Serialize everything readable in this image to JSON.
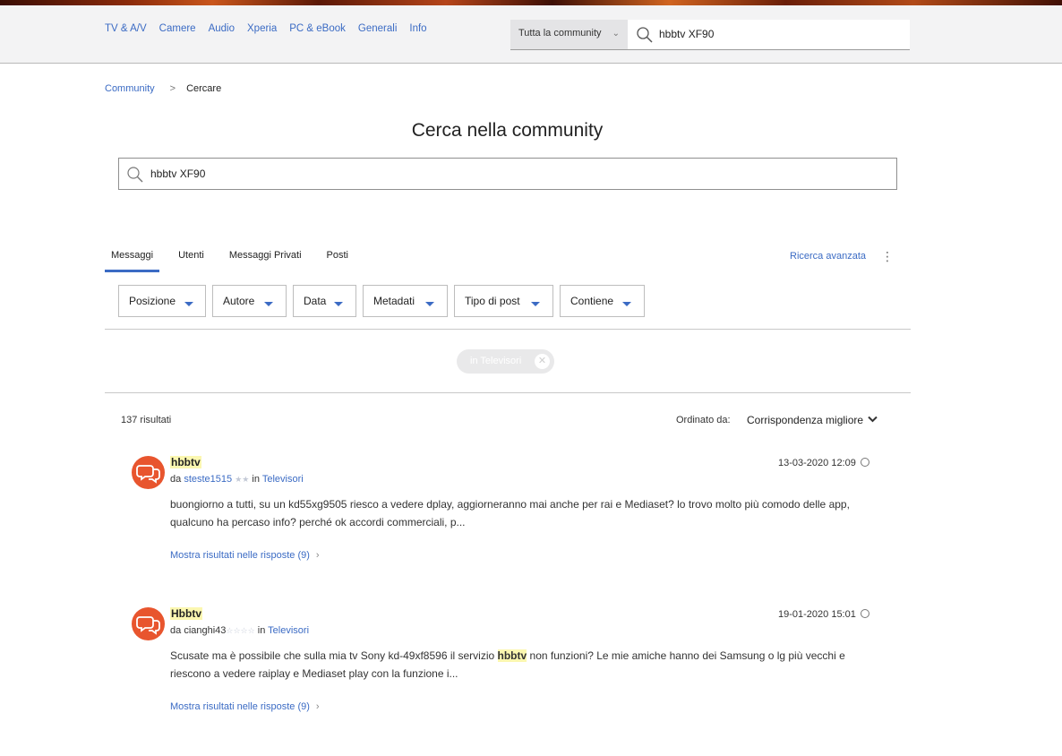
{
  "nav": {
    "links": [
      "TV & A/V",
      "Camere",
      "Audio",
      "Xperia",
      "PC & eBook",
      "Generali",
      "Info"
    ]
  },
  "header_search": {
    "scope": "Tutta la community",
    "query": "hbbtv XF90"
  },
  "breadcrumb": {
    "root": "Community",
    "separator": ">",
    "current": "Cercare"
  },
  "page_title": "Cerca nella community",
  "main_search": {
    "query": "hbbtv XF90"
  },
  "tabs": [
    {
      "label": "Messaggi",
      "active": true
    },
    {
      "label": "Utenti",
      "active": false
    },
    {
      "label": "Messaggi Privati",
      "active": false
    },
    {
      "label": "Posti",
      "active": false
    }
  ],
  "advanced_search_label": "Ricerca avanzata",
  "filters": [
    "Posizione",
    "Autore",
    "Data",
    "Metadati",
    "Tipo di post",
    "Contiene"
  ],
  "active_filter_chip": "in Televisori",
  "results_count": "137 risultati",
  "sort": {
    "label": "Ordinato da:",
    "value": "Corrispondenza migliore"
  },
  "results": [
    {
      "title": "hbbtv",
      "by": "da",
      "author": "steste1515",
      "author_stars": "★★",
      "in_word": "in",
      "board": "Televisori",
      "date": "13-03-2020 12:09",
      "body_before": "buongiorno a tutti, su un kd55xg9505 riesco a vedere dplay, aggiorneranno mai anche per rai e Mediaset? lo trovo molto più comodo delle app, qualcuno ha percaso info? perché ok accordi commerciali, p...",
      "body_highlight": "",
      "body_after": "",
      "more_label": "Mostra risultati nelle risposte (9)"
    },
    {
      "title": "Hbbtv",
      "by": "da",
      "author": "cianghi43",
      "author_stars": "☆☆☆☆",
      "in_word": "in",
      "board": "Televisori",
      "date": "19-01-2020 15:01",
      "body_before": "Scusate ma è possibile che sulla mia tv Sony kd-49xf8596 il servizio ",
      "body_highlight": "hbbtv",
      "body_after": " non funzioni? Le mie amiche hanno dei Samsung o lg più vecchi e riescono a vedere raiplay e Mediaset play con la funzione i...",
      "more_label": "Mostra risultati nelle risposte (9)"
    }
  ],
  "colors": {
    "accent": "#3b6bc4",
    "avatar": "#e8552e",
    "highlight": "#fbf7b0"
  }
}
